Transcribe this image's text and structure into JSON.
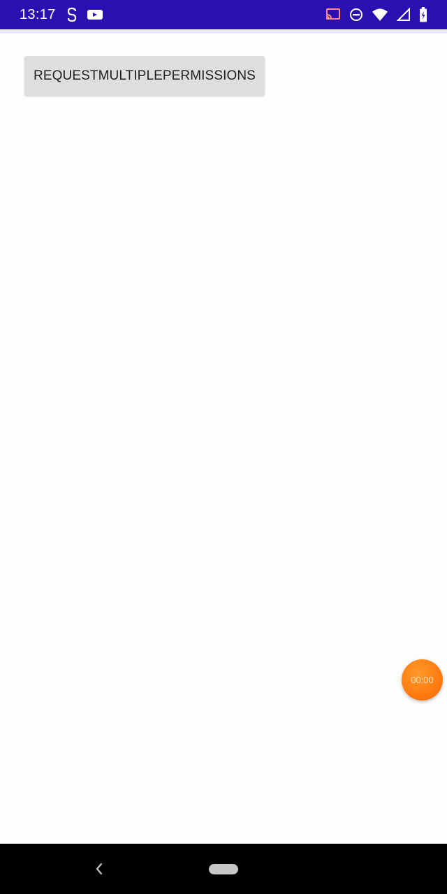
{
  "status_bar": {
    "time": "13:17",
    "left_icons": [
      "sync-icon",
      "video-camera-icon"
    ],
    "right_icons": [
      "cast-icon",
      "do-not-disturb-icon",
      "wifi-icon",
      "signal-icon",
      "battery-icon"
    ]
  },
  "main": {
    "request_button_label": "REQUESTMULTIPLEPERMISSIONS"
  },
  "overlay": {
    "timer_text": "00:00"
  },
  "nav_bar": {
    "icons": [
      "back-icon",
      "home-pill"
    ]
  },
  "colors": {
    "status_bar_bg": "#2c0fb0",
    "button_bg": "#dedede",
    "timer_bubble": "#ff7b10",
    "nav_bar_bg": "#000000"
  }
}
